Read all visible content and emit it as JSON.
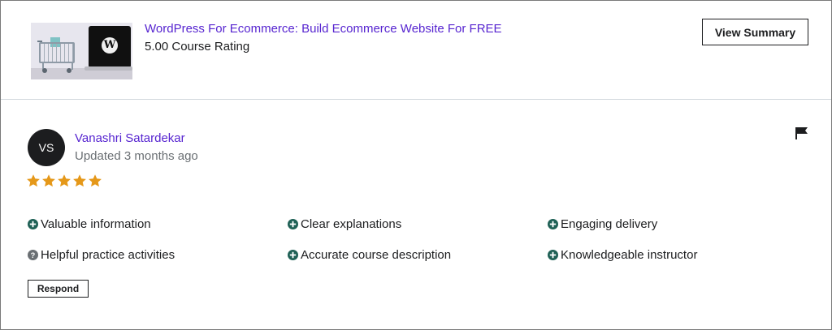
{
  "course": {
    "title": "WordPress For Ecommerce: Build Ecommerce Website For FREE",
    "rating_text": "5.00 Course Rating",
    "view_summary_label": "View Summary"
  },
  "review": {
    "avatar_initials": "VS",
    "reviewer_name": "Vanashri Satardekar",
    "updated": "Updated 3 months ago",
    "rating": 5,
    "star_color": "#e59819",
    "feedback": {
      "col1": [
        {
          "label": "Valuable information",
          "icon": "plus-circle-icon"
        },
        {
          "label": "Helpful practice activities",
          "icon": "question-circle-icon"
        }
      ],
      "col2": [
        {
          "label": "Clear explanations",
          "icon": "plus-circle-icon"
        },
        {
          "label": "Accurate course description",
          "icon": "plus-circle-icon"
        }
      ],
      "col3": [
        {
          "label": "Engaging delivery",
          "icon": "plus-circle-icon"
        },
        {
          "label": "Knowledgeable instructor",
          "icon": "plus-circle-icon"
        }
      ]
    },
    "respond_label": "Respond"
  },
  "colors": {
    "link": "#5624d0",
    "positive_icon": "#1e6055",
    "question_icon": "#6a6f73"
  }
}
